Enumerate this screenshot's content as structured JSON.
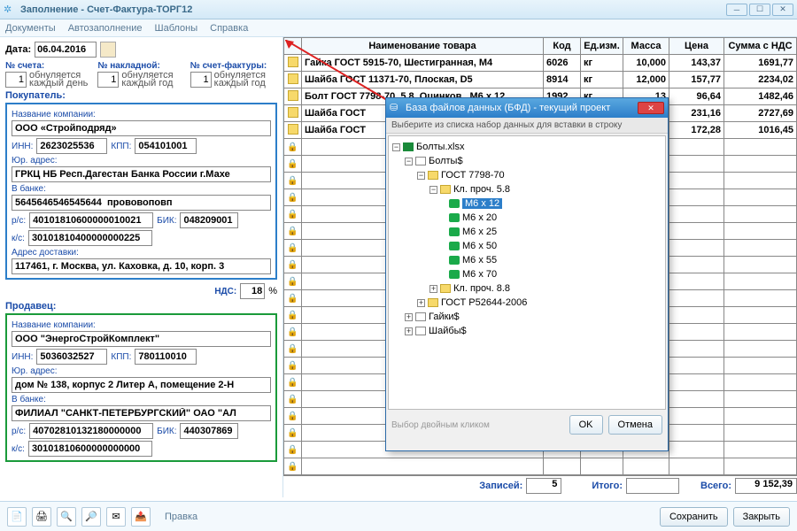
{
  "window": {
    "title": "Заполнение - Счет-Фактура-ТОРГ12"
  },
  "menu": [
    "Документы",
    "Автозаполнение",
    "Шаблоны",
    "Справка"
  ],
  "date": {
    "label": "Дата:",
    "value": "06.04.2016"
  },
  "counters": {
    "acct": {
      "label": "№ счета:",
      "val": "1",
      "note1": "обнуляется",
      "note2": "каждый день"
    },
    "nakl": {
      "label": "№ накладной:",
      "val": "1",
      "note1": "обнуляется",
      "note2": "каждый год"
    },
    "sf": {
      "label": "№ счет-фактуры:",
      "val": "1",
      "note1": "обнуляется",
      "note2": "каждый год"
    }
  },
  "buyer": {
    "heading": "Покупатель:",
    "company_lbl": "Название компании:",
    "company": "ООО «Стройподряд»",
    "inn_lbl": "ИНН:",
    "inn": "2623025536",
    "kpp_lbl": "КПП:",
    "kpp": "054101001",
    "addr_lbl": "Юр. адрес:",
    "addr": "ГРКЦ НБ Респ.Дагестан Банка России г.Махе",
    "bank_lbl": "В банке:",
    "bank": "5645646546545644  прововоповп",
    "rs_lbl": "р/с:",
    "rs": "40101810600000010021",
    "bik_lbl": "БИК:",
    "bik": "048209001",
    "ks_lbl": "к/с:",
    "ks": "30101810400000000225",
    "deliv_lbl": "Адрес доставки:",
    "deliv": "117461, г. Москва, ул. Каховка, д. 10, корп. 3"
  },
  "nds": {
    "label": "НДС:",
    "val": "18",
    "pct": "%"
  },
  "seller": {
    "heading": "Продавец:",
    "company_lbl": "Название компании:",
    "company": "ООО \"ЭнергоСтройКомплект\"",
    "inn_lbl": "ИНН:",
    "inn": "5036032527",
    "kpp_lbl": "КПП:",
    "kpp": "780110010",
    "addr_lbl": "Юр. адрес:",
    "addr": "дом № 138, корпус 2 Литер А, помещение 2-Н",
    "bank_lbl": "В банке:",
    "bank": "ФИЛИАЛ \"САНКТ-ПЕТЕРБУРГСКИЙ\" ОАО \"АЛ",
    "rs_lbl": "р/с:",
    "rs": "40702810132180000000",
    "bik_lbl": "БИК:",
    "bik": "440307869",
    "ks_lbl": "к/с:",
    "ks": "30101810600000000000"
  },
  "grid": {
    "headers": [
      "",
      "Наименование товара",
      "Код",
      "Ед.изм.",
      "Масса",
      "Цена",
      "Сумма с НДС"
    ],
    "rows": [
      {
        "edit": true,
        "name": "Гайка ГОСТ 5915-70, Шестигранная, М4",
        "code": "6026",
        "unit": "кг",
        "mass": "10,000",
        "price": "143,37",
        "sum": "1691,77"
      },
      {
        "edit": true,
        "name": "Шайба ГОСТ 11371-70, Плоская, D5",
        "code": "8914",
        "unit": "кг",
        "mass": "12,000",
        "price": "157,77",
        "sum": "2234,02"
      },
      {
        "edit": true,
        "name": "Болт ГОСТ 7798-70, 5.8, Оцинков., М6 х 12",
        "code": "1992",
        "unit": "кг",
        "mass": "13",
        "price": "96,64",
        "sum": "1482,46"
      },
      {
        "edit": true,
        "name": "Шайба ГОСТ",
        "code": "",
        "unit": "",
        "mass": "",
        "price": "231,16",
        "sum": "2727,69"
      },
      {
        "edit": true,
        "name": "Шайба ГОСТ",
        "code": "",
        "unit": "",
        "mass": "",
        "price": "172,28",
        "sum": "1016,45"
      }
    ],
    "totals": {
      "records_lbl": "Записей:",
      "records": "5",
      "itogo_lbl": "Итого:",
      "vsego_lbl": "Всего:",
      "vsego": "9 152,39"
    }
  },
  "dialog": {
    "title": "База файлов данных (БФД) - текущий проект",
    "subtitle": "Выберите из списка набор данных для вставки в строку",
    "tree": {
      "root": "Болты.xlsx",
      "sheet": "Болты$",
      "g1": "ГОСТ 7798-70",
      "cls": "Кл. проч. 5.8",
      "items": [
        "М6 х 12",
        "М6 х 20",
        "М6 х 25",
        "М6 х 50",
        "М6 х 55",
        "М6 х 70"
      ],
      "cls2": "Кл. проч. 8.8",
      "g2": "ГОСТ Р52644-2006",
      "sheet2": "Гайки$",
      "sheet3": "Шайбы$"
    },
    "hint": "Выбор двойным кликом",
    "ok": "OK",
    "cancel": "Отмена"
  },
  "footer": {
    "pravka": "Правка",
    "save": "Сохранить",
    "close": "Закрыть"
  }
}
